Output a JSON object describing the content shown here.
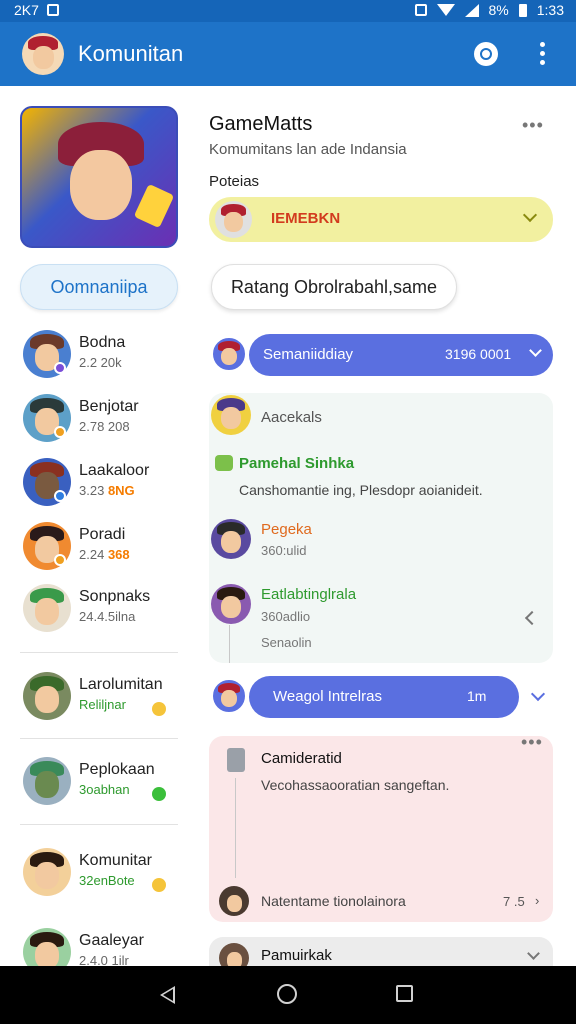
{
  "status_bar": {
    "left_text": "2K7",
    "battery": "8%",
    "time": "1:33"
  },
  "app_bar": {
    "title": "Komunitan",
    "icons": [
      "community-logo-icon",
      "search-icon",
      "more-vert-icon"
    ]
  },
  "community": {
    "name": "GameMatts",
    "description": "Komumitans lan ade Indansia",
    "section_label": "Poteias",
    "featured_banner": "IEMEBKN",
    "join_button": "Oomnaniipa",
    "room_button": "Ratang Obrolrabahl,same"
  },
  "friends": [
    {
      "name": "Bodna",
      "sub": "2.2 20k",
      "highlight": "",
      "sub_style": "plain",
      "status_color": "#7a4ed8"
    },
    {
      "name": "Benjotar",
      "sub": "2.78 208",
      "highlight": "",
      "sub_style": "plain",
      "status_color": "#f0a020"
    },
    {
      "name": "Laakaloor",
      "sub": "3.23",
      "highlight": "8NG",
      "sub_style": "plain",
      "status_color": "#2f7de0"
    },
    {
      "name": "Poradi",
      "sub": "2.24",
      "highlight": "368",
      "sub_style": "plain",
      "status_color": "#f0a020"
    },
    {
      "name": "Sonpnaks",
      "sub": "24.4.5ilna",
      "highlight": "",
      "sub_style": "plain",
      "status_color": ""
    },
    {
      "name": "Larolumitan",
      "sub": "Reliljnar",
      "highlight": "",
      "sub_style": "green",
      "status_color": "#f5c43a"
    },
    {
      "name": "Peplokaan",
      "sub": "3oabhan",
      "highlight": "",
      "sub_style": "green",
      "status_color": "#3bbf3b"
    },
    {
      "name": "Komunitar",
      "sub": "32enBote",
      "highlight": "",
      "sub_style": "green",
      "status_color": "#f5c43a"
    },
    {
      "name": "Gaaleyar",
      "sub": "2.4.0 1ilr",
      "highlight": "",
      "sub_style": "plain",
      "status_color": ""
    }
  ],
  "channels": {
    "top": {
      "name": "Semaniiddiay",
      "count": "3196 0001"
    },
    "bottom": {
      "name": "Weagol Intrelras",
      "count": "1m"
    }
  },
  "thread": {
    "header": "Aacekals",
    "post_title": "Pamehal Sinhka",
    "post_body": "Canshomantie ing, Plesdopr aoianideit.",
    "replies": [
      {
        "name": "Pegeka",
        "sub": "360:ulid",
        "name_color": "#e06a1e"
      },
      {
        "name": "Eatlabtinglrala",
        "sub": "360adlio",
        "name_color": "#2e9a2e"
      }
    ],
    "footer": "Senaolin"
  },
  "pink_post": {
    "title": "Camideratid",
    "body": "Vecohassaooratian sangeftan.",
    "footer_text": "Natentame tionolainora",
    "footer_meta": "7 .5"
  },
  "bottom_card": {
    "title": "Pamuirkak"
  },
  "colors": {
    "primary": "#1e73c8",
    "channel": "#5a6fe0",
    "panel": "#f2f7f5",
    "pink": "#fbe7e8",
    "banner": "#f2f0a0"
  }
}
